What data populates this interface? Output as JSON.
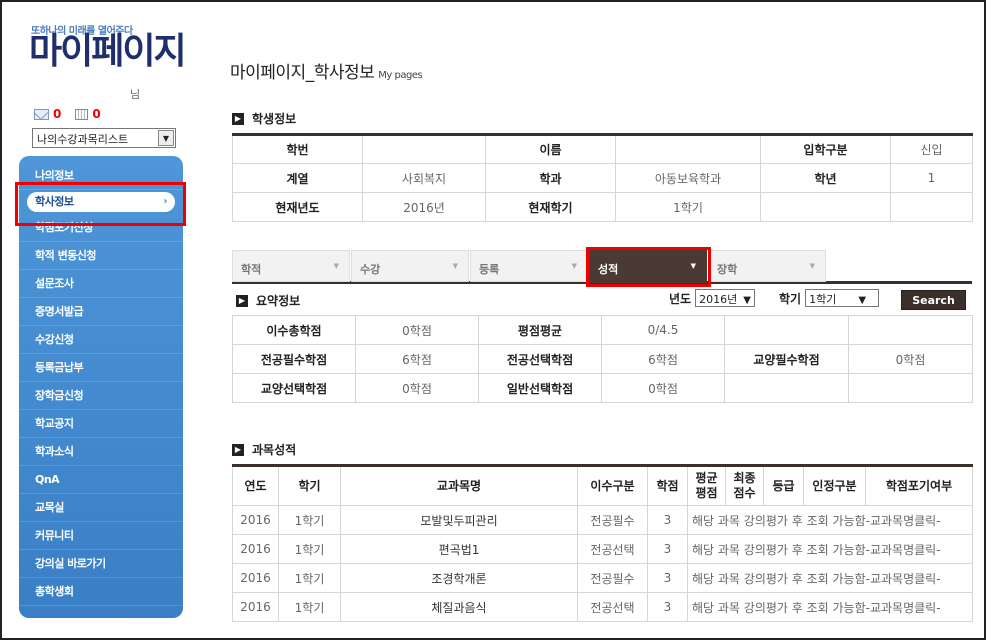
{
  "header": {
    "slogan": "또하나의 미래를 열어주다",
    "brand": "마이페이지",
    "nim": "님",
    "mail_count": "0",
    "calendar_count": "0",
    "course_select": "나의수강과목리스트"
  },
  "sidebar": {
    "items": [
      {
        "label": "나의정보"
      },
      {
        "label": "학사정보",
        "active": true
      },
      {
        "label": "학점포기신청"
      },
      {
        "label": "학적 변동신청"
      },
      {
        "label": "설문조사"
      },
      {
        "label": "증명서발급"
      },
      {
        "label": "수강신청"
      },
      {
        "label": "등록금납부"
      },
      {
        "label": "장학금신청"
      },
      {
        "label": "학교공지"
      },
      {
        "label": "학과소식"
      },
      {
        "label": "QnA"
      },
      {
        "label": "교목실"
      },
      {
        "label": "커뮤니티"
      },
      {
        "label": "강의실 바로가기"
      },
      {
        "label": "총학생회"
      }
    ]
  },
  "main": {
    "title": "마이페이지_학사정보",
    "title_sub": "My pages",
    "student_section": "학생정보",
    "student_rows": [
      [
        {
          "h": "학번"
        },
        {
          "v": ""
        },
        {
          "h": "이름"
        },
        {
          "v": ""
        },
        {
          "h": "입학구분"
        },
        {
          "v": "신입"
        }
      ],
      [
        {
          "h": "계열"
        },
        {
          "v": "사회복지"
        },
        {
          "h": "학과"
        },
        {
          "v": "아동보육학과"
        },
        {
          "h": "학년"
        },
        {
          "v": "1"
        }
      ],
      [
        {
          "h": "현재년도"
        },
        {
          "v": "2016년"
        },
        {
          "h": "현재학기"
        },
        {
          "v": "1학기"
        },
        {
          "v": ""
        },
        {
          "v": ""
        }
      ]
    ],
    "tabs": [
      {
        "label": "학적"
      },
      {
        "label": "수강"
      },
      {
        "label": "등록"
      },
      {
        "label": "성적",
        "active": true
      },
      {
        "label": "장학"
      }
    ],
    "summary_section": "요약정보",
    "filter": {
      "year_label": "년도",
      "year_value": "2016년",
      "term_label": "학기",
      "term_value": "1학기",
      "search_label": "Search"
    },
    "summary_rows": [
      [
        {
          "h": "이수총학점"
        },
        {
          "v": "0학점"
        },
        {
          "h": "평점평균"
        },
        {
          "v": "0/4.5"
        },
        {
          "v": ""
        },
        {
          "v": ""
        }
      ],
      [
        {
          "h": "전공필수학점"
        },
        {
          "v": "6학점"
        },
        {
          "h": "전공선택학점"
        },
        {
          "v": "6학점"
        },
        {
          "h": "교양필수학점"
        },
        {
          "v": "0학점"
        }
      ],
      [
        {
          "h": "교양선택학점"
        },
        {
          "v": "0학점"
        },
        {
          "h": "일반선택학점"
        },
        {
          "v": "0학점"
        },
        {
          "v": ""
        },
        {
          "v": ""
        }
      ]
    ],
    "grades_section": "과목성적",
    "grades_headers": [
      "연도",
      "학기",
      "교과목명",
      "이수구분",
      "학점",
      "평균\n평점",
      "최종\n점수",
      "등급",
      "인정구분",
      "학점포기여부"
    ],
    "grades_rows": [
      {
        "year": "2016",
        "term": "1학기",
        "course": "모발및두피관리",
        "type": "전공필수",
        "credit": "3",
        "note": "해당 과목 강의평가 후 조회 가능함-교과목명클릭-"
      },
      {
        "year": "2016",
        "term": "1학기",
        "course": "편곡법1",
        "type": "전공선택",
        "credit": "3",
        "note": "해당 과목 강의평가 후 조회 가능함-교과목명클릭-"
      },
      {
        "year": "2016",
        "term": "1학기",
        "course": "조경학개론",
        "type": "전공필수",
        "credit": "3",
        "note": "해당 과목 강의평가 후 조회 가능함-교과목명클릭-"
      },
      {
        "year": "2016",
        "term": "1학기",
        "course": "체질과음식",
        "type": "전공선택",
        "credit": "3",
        "note": "해당 과목 강의평가 후 조회 가능함-교과목명클릭-"
      }
    ]
  }
}
